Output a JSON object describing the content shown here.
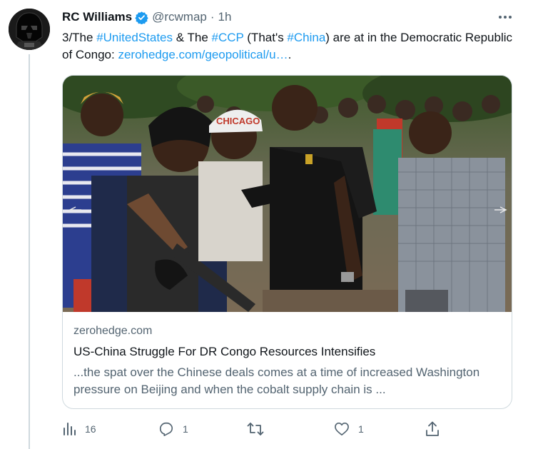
{
  "author": {
    "display_name": "RC Williams",
    "handle": "@rcwmap",
    "separator": "·",
    "time": "1h"
  },
  "tweet": {
    "prefix": "3/The ",
    "tag1": "#UnitedStates",
    "mid1": " & The ",
    "tag2": "#CCP",
    "mid2": " (That's ",
    "tag3": "#China",
    "mid3": ") are at in the Democratic Republic of Congo: ",
    "url": "zerohedge.com/geopolitical/u…",
    "suffix": "."
  },
  "card": {
    "domain": "zerohedge.com",
    "title": "US-China Struggle For DR Congo Resources Intensifies",
    "description": "...the spat over the Chinese deals comes at a time of increased Washington pressure on Beijing and when the cobalt supply chain is ...",
    "cap_text": "CHICAGO"
  },
  "actions": {
    "views": "16",
    "replies": "1",
    "retweets": "",
    "likes": "1"
  },
  "colors": {
    "link": "#1d9bf0",
    "secondary_text": "#536471",
    "border": "#cfd9de"
  },
  "icons": [
    "verified-badge-icon",
    "more-icon",
    "analytics-icon",
    "reply-icon",
    "retweet-icon",
    "like-icon",
    "share-icon"
  ]
}
